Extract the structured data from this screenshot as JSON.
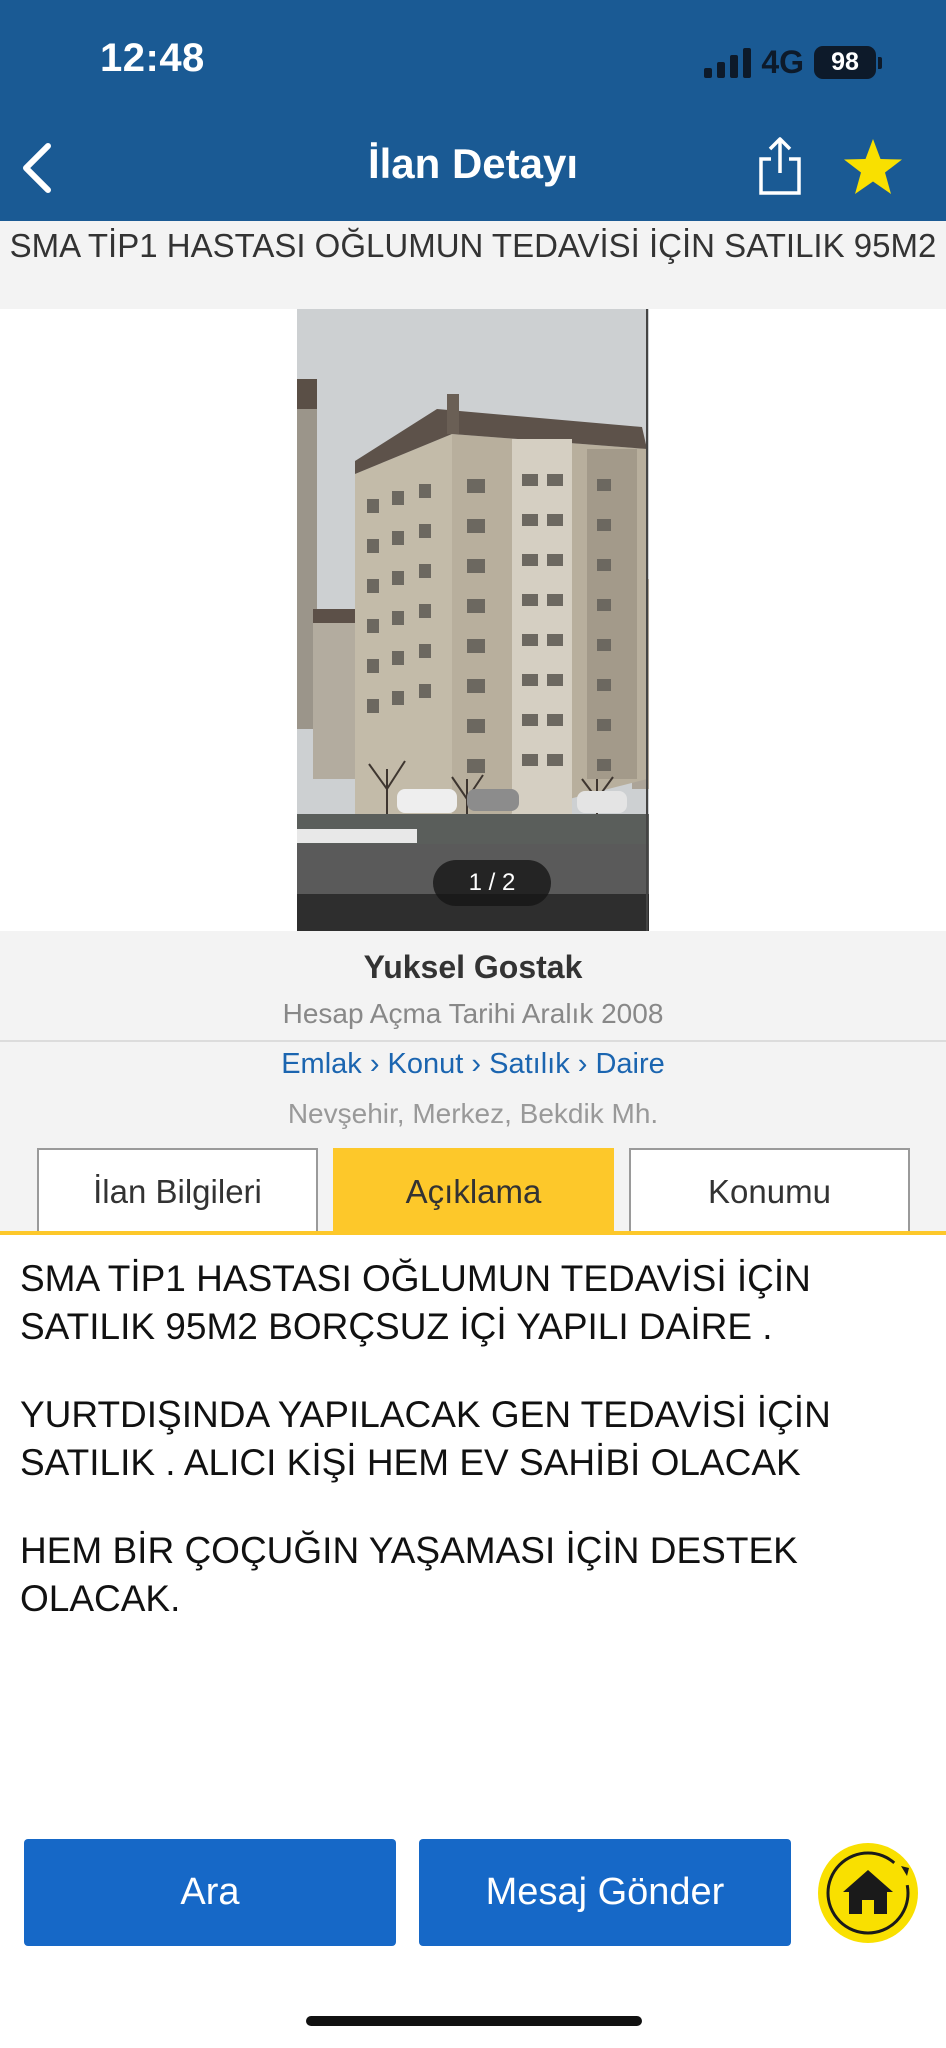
{
  "status_bar": {
    "time": "12:48",
    "network": "4G",
    "battery": "98"
  },
  "nav": {
    "title": "İlan Detayı"
  },
  "listing": {
    "title": "SMA TİP1 HASTASI OĞLUMUN TEDAVİSİ İÇİN SATILIK 95M2"
  },
  "gallery": {
    "counter": "1 / 2"
  },
  "seller": {
    "name": "Yuksel Gostak",
    "since": "Hesap Açma Tarihi  Aralık 2008"
  },
  "category": {
    "breadcrumb": "Emlak › Konut › Satılık › Daire",
    "location": "Nevşehir, Merkez, Bekdik Mh."
  },
  "tabs": [
    {
      "label": "İlan Bilgileri"
    },
    {
      "label": "Açıklama"
    },
    {
      "label": "Konumu"
    }
  ],
  "description": [
    "SMA TİP1 HASTASI OĞLUMUN TEDAVİSİ İÇİN SATILIK 95M2 BORÇSUZ İÇİ YAPILI DAİRE .",
    "YURTDIŞINDA YAPILACAK GEN TEDAVİSİ İÇİN SATILIK . ALICI KİŞİ HEM EV SAHİBİ OLACAK",
    "HEM BİR ÇOÇUĞIN YAŞAMASI İÇİN DESTEK OLACAK."
  ],
  "actions": {
    "call_label": "Ara",
    "message_label": "Mesaj Gönder"
  },
  "colors": {
    "header": "#1a5a94",
    "accent": "#fdc82a",
    "primary_button": "#1668c7",
    "link": "#1b65b0"
  }
}
